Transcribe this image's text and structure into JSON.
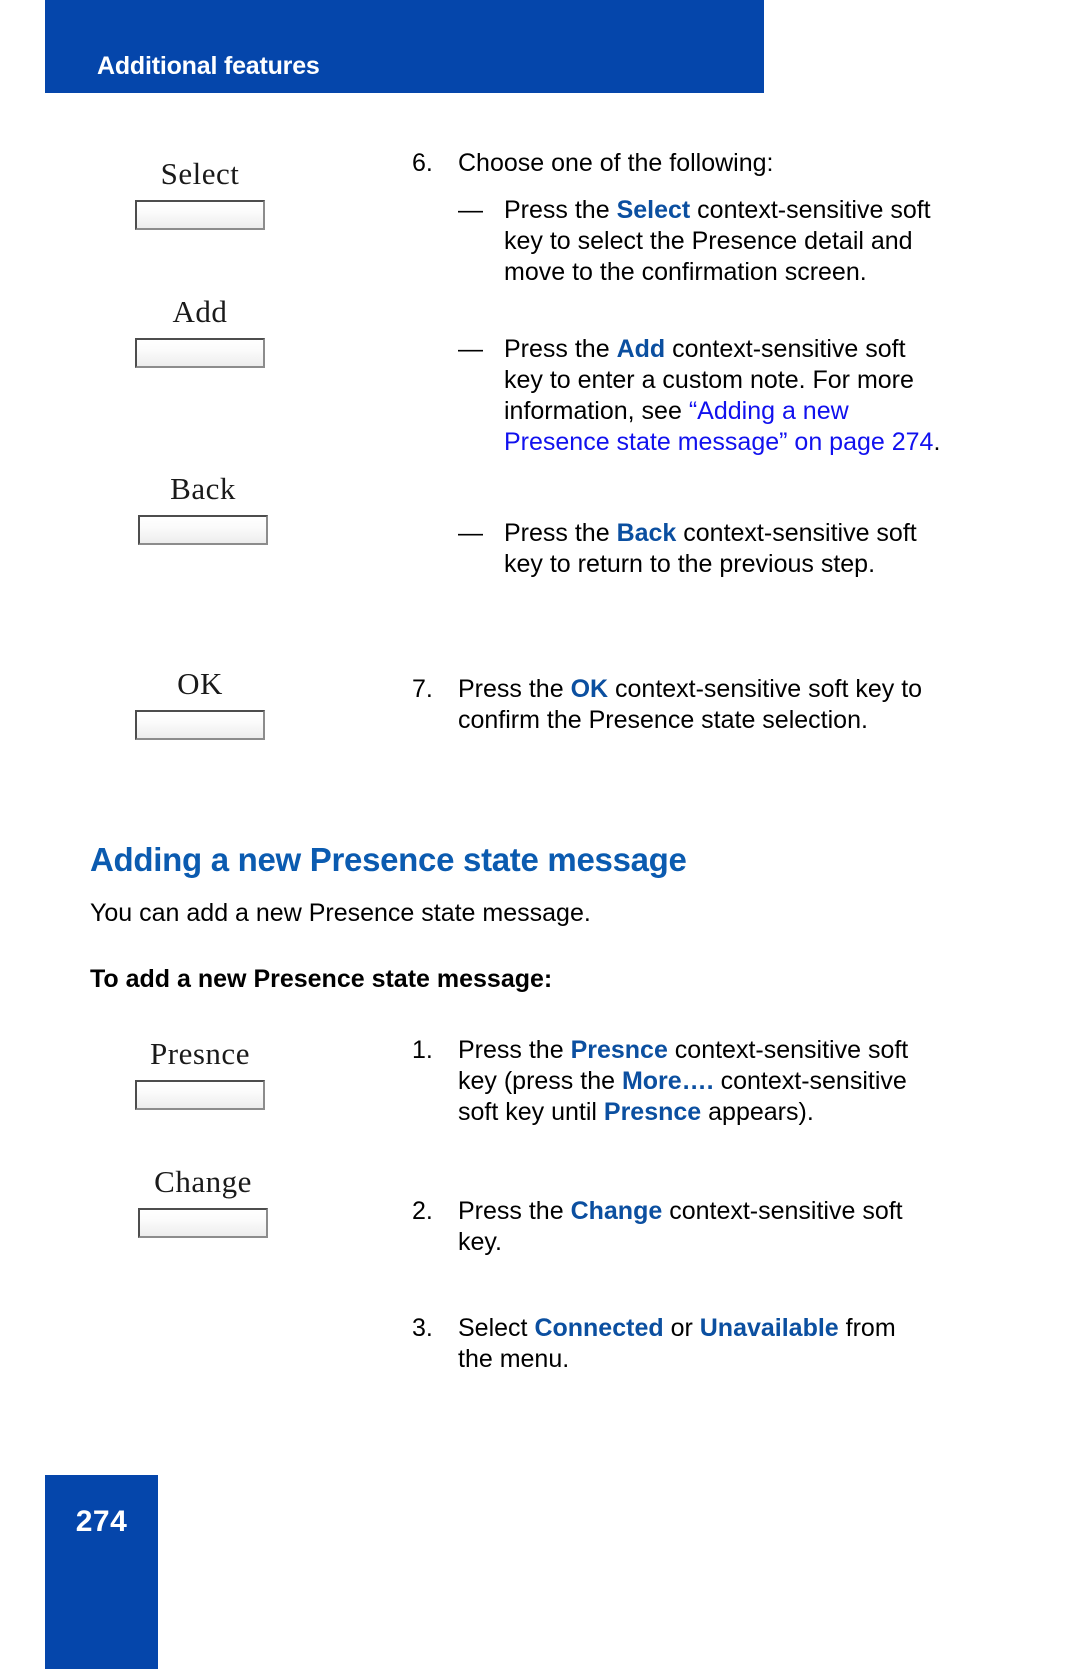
{
  "header": {
    "title": "Additional features",
    "band_color": "#0546ab"
  },
  "colors": {
    "brand_blue": "#0546ab",
    "heading_blue": "#0b5bb0",
    "softkey_blue": "#0b4fa0",
    "xref_blue": "#1111ee"
  },
  "softkeys": {
    "select": "Select",
    "add": "Add",
    "back": "Back",
    "ok": "OK",
    "presnce": "Presnce",
    "change": "Change"
  },
  "steps": [
    {
      "number": "6.",
      "text": "Choose one of the following:",
      "subitems": [
        {
          "marker": "—",
          "parts": [
            {
              "type": "text",
              "value": "Press the "
            },
            {
              "type": "softkey",
              "value": "Select"
            },
            {
              "type": "text",
              "value": " context-sensitive soft key to select the Presence detail and move to the confirmation screen."
            }
          ]
        },
        {
          "marker": "—",
          "parts": [
            {
              "type": "text",
              "value": "Press the "
            },
            {
              "type": "softkey",
              "value": "Add"
            },
            {
              "type": "text",
              "value": " context-sensitive soft key to enter a custom note. For more information, see "
            },
            {
              "type": "xref",
              "value": "“Adding a new Presence state message” on page 274"
            },
            {
              "type": "text",
              "value": "."
            }
          ]
        },
        {
          "marker": "—",
          "parts": [
            {
              "type": "text",
              "value": "Press the "
            },
            {
              "type": "softkey",
              "value": "Back"
            },
            {
              "type": "text",
              "value": " context-sensitive soft key to return to the previous step."
            }
          ]
        }
      ]
    },
    {
      "number": "7.",
      "parts": [
        {
          "type": "text",
          "value": "Press the "
        },
        {
          "type": "softkey",
          "value": "OK"
        },
        {
          "type": "text",
          "value": " context-sensitive soft key to confirm the Presence state selection."
        }
      ]
    }
  ],
  "section": {
    "heading": "Adding a new Presence state message",
    "intro": "You can add a new Presence state message.",
    "procedure_title": "To add a new Presence state message:",
    "steps": [
      {
        "number": "1.",
        "parts": [
          {
            "type": "text",
            "value": "Press the "
          },
          {
            "type": "softkey",
            "value": "Presnce"
          },
          {
            "type": "text",
            "value": " context-sensitive soft key (press the "
          },
          {
            "type": "softkey",
            "value": "More…."
          },
          {
            "type": "text",
            "value": " context-sensitive soft key until "
          },
          {
            "type": "softkey",
            "value": "Presnce"
          },
          {
            "type": "text",
            "value": " appears)."
          }
        ]
      },
      {
        "number": "2.",
        "parts": [
          {
            "type": "text",
            "value": "Press the "
          },
          {
            "type": "softkey",
            "value": "Change"
          },
          {
            "type": "text",
            "value": " context-sensitive soft key."
          }
        ]
      },
      {
        "number": "3.",
        "parts": [
          {
            "type": "text",
            "value": "Select "
          },
          {
            "type": "softkey",
            "value": "Connected"
          },
          {
            "type": "text",
            "value": " or "
          },
          {
            "type": "softkey",
            "value": "Unavailable"
          },
          {
            "type": "text",
            "value": " from the menu."
          }
        ]
      }
    ]
  },
  "footer": {
    "page_number": "274"
  }
}
